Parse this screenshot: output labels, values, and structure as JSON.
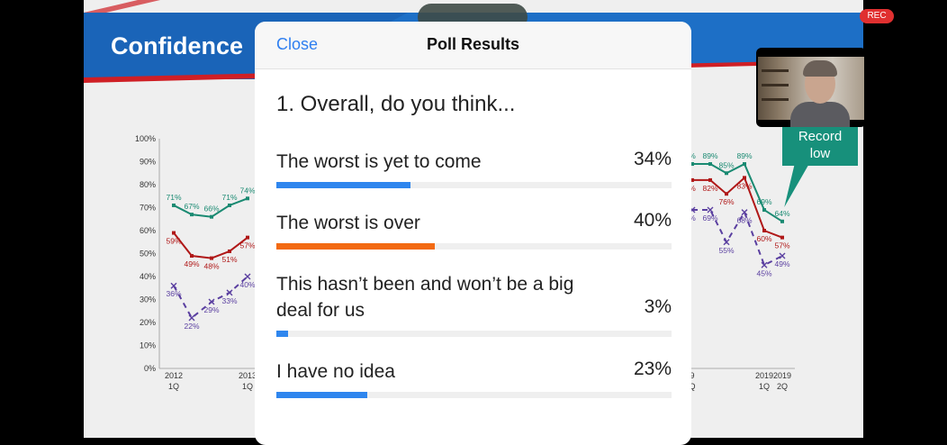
{
  "slide": {
    "title": "Confidence",
    "callout": [
      "Record",
      "low"
    ]
  },
  "recording_badge": "REC",
  "webcam": {
    "content": "video thumbnail of presenter"
  },
  "modal": {
    "close_label": "Close",
    "title": "Poll Results",
    "question": "1. Overall, do you think...",
    "answers": [
      {
        "label": "The worst is yet to come",
        "percent": "34%",
        "value": 34,
        "color": "#2f86ee"
      },
      {
        "label": "The worst is over",
        "percent": "40%",
        "value": 40,
        "color": "#f36a12"
      },
      {
        "label": "This hasn’t been and won’t be a big deal for us",
        "percent": "3%",
        "value": 3,
        "color": "#2f86ee"
      },
      {
        "label": "I have no idea",
        "percent": "23%",
        "value": 23,
        "color": "#2f86ee"
      }
    ]
  },
  "chart_data": {
    "type": "line",
    "ylim": [
      0,
      100
    ],
    "y_ticks": [
      "100%",
      "90%",
      "80%",
      "70%",
      "60%",
      "50%",
      "40%",
      "30%",
      "20%",
      "10%",
      "0%"
    ],
    "x_ticks": [
      {
        "year": "2012",
        "q": "1Q"
      },
      {
        "year": "2013",
        "q": "1Q"
      },
      {
        "year": "9",
        "q": "Q"
      },
      {
        "year": "2019",
        "q": "1Q"
      },
      {
        "year": "2019",
        "q": "2Q"
      }
    ],
    "colors": {
      "green": "#1a8a72",
      "red": "#b01818",
      "purple": "#5a3fa0"
    },
    "left_segment": {
      "series": [
        {
          "color_key": "green",
          "dashed": false,
          "values": [
            71,
            67,
            66,
            71,
            74
          ],
          "labels": [
            "71%",
            "67%",
            "66%",
            "71%",
            "74%"
          ]
        },
        {
          "color_key": "red",
          "dashed": false,
          "values": [
            59,
            49,
            48,
            51,
            57
          ],
          "labels": [
            "59%",
            "49%",
            "48%",
            "51%",
            "57%"
          ]
        },
        {
          "color_key": "purple",
          "dashed": true,
          "values": [
            36,
            22,
            29,
            33,
            40
          ],
          "labels": [
            "36%",
            "22%",
            "29%",
            "33%",
            "40%"
          ]
        }
      ]
    },
    "right_segment": {
      "series": [
        {
          "color_key": "green",
          "dashed": false,
          "values": [
            89,
            89,
            85,
            89,
            69,
            64
          ],
          "labels": [
            "%",
            "89%",
            "85%",
            "89%",
            "69%",
            "64%"
          ]
        },
        {
          "color_key": "red",
          "dashed": false,
          "values": [
            82,
            82,
            76,
            83,
            60,
            57
          ],
          "labels": [
            "%",
            "82%",
            "76%",
            "83%",
            "60%",
            "57%"
          ]
        },
        {
          "color_key": "purple",
          "dashed": true,
          "values": [
            69,
            69,
            55,
            68,
            45,
            49
          ],
          "labels": [
            "%",
            "69%",
            "55%",
            "68%",
            "45%",
            "49%"
          ]
        }
      ]
    }
  }
}
